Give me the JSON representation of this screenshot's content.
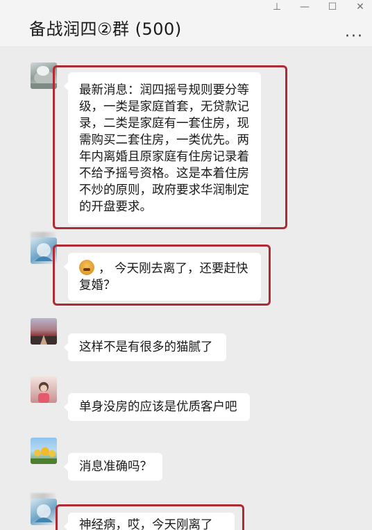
{
  "window": {
    "title": "备战润四②群 (500)",
    "controls": {
      "pin": "⊥",
      "minimize": "—",
      "maximize": "☐",
      "close": "✕"
    },
    "more": "···"
  },
  "messages": [
    {
      "text": "最新消息：润四摇号规则要分等级，一类是家庭首套，无贷款记录，二类是家庭有一套住房，现需购买二套住房，一类优先。两年内离婚且原家庭有住房记录着不给予摇号资格。这是本着住房不炒的原则，政府要求华润制定的开盘要求。",
      "highlighted": true
    },
    {
      "text": "，  今天刚去离了，还要赶快复婚？",
      "has_emoji": true,
      "highlighted": true
    },
    {
      "text": "这样不是有很多的猫腻了",
      "highlighted": false
    },
    {
      "text": "单身没房的应该是优质客户吧",
      "highlighted": false
    },
    {
      "text": "消息准确吗？",
      "highlighted": false
    },
    {
      "text": "神经病，哎，今天刚离了",
      "highlighted": true
    }
  ],
  "colors": {
    "highlight_frame": "#b02a33",
    "background": "#ececec",
    "bubble": "#ffffff"
  }
}
